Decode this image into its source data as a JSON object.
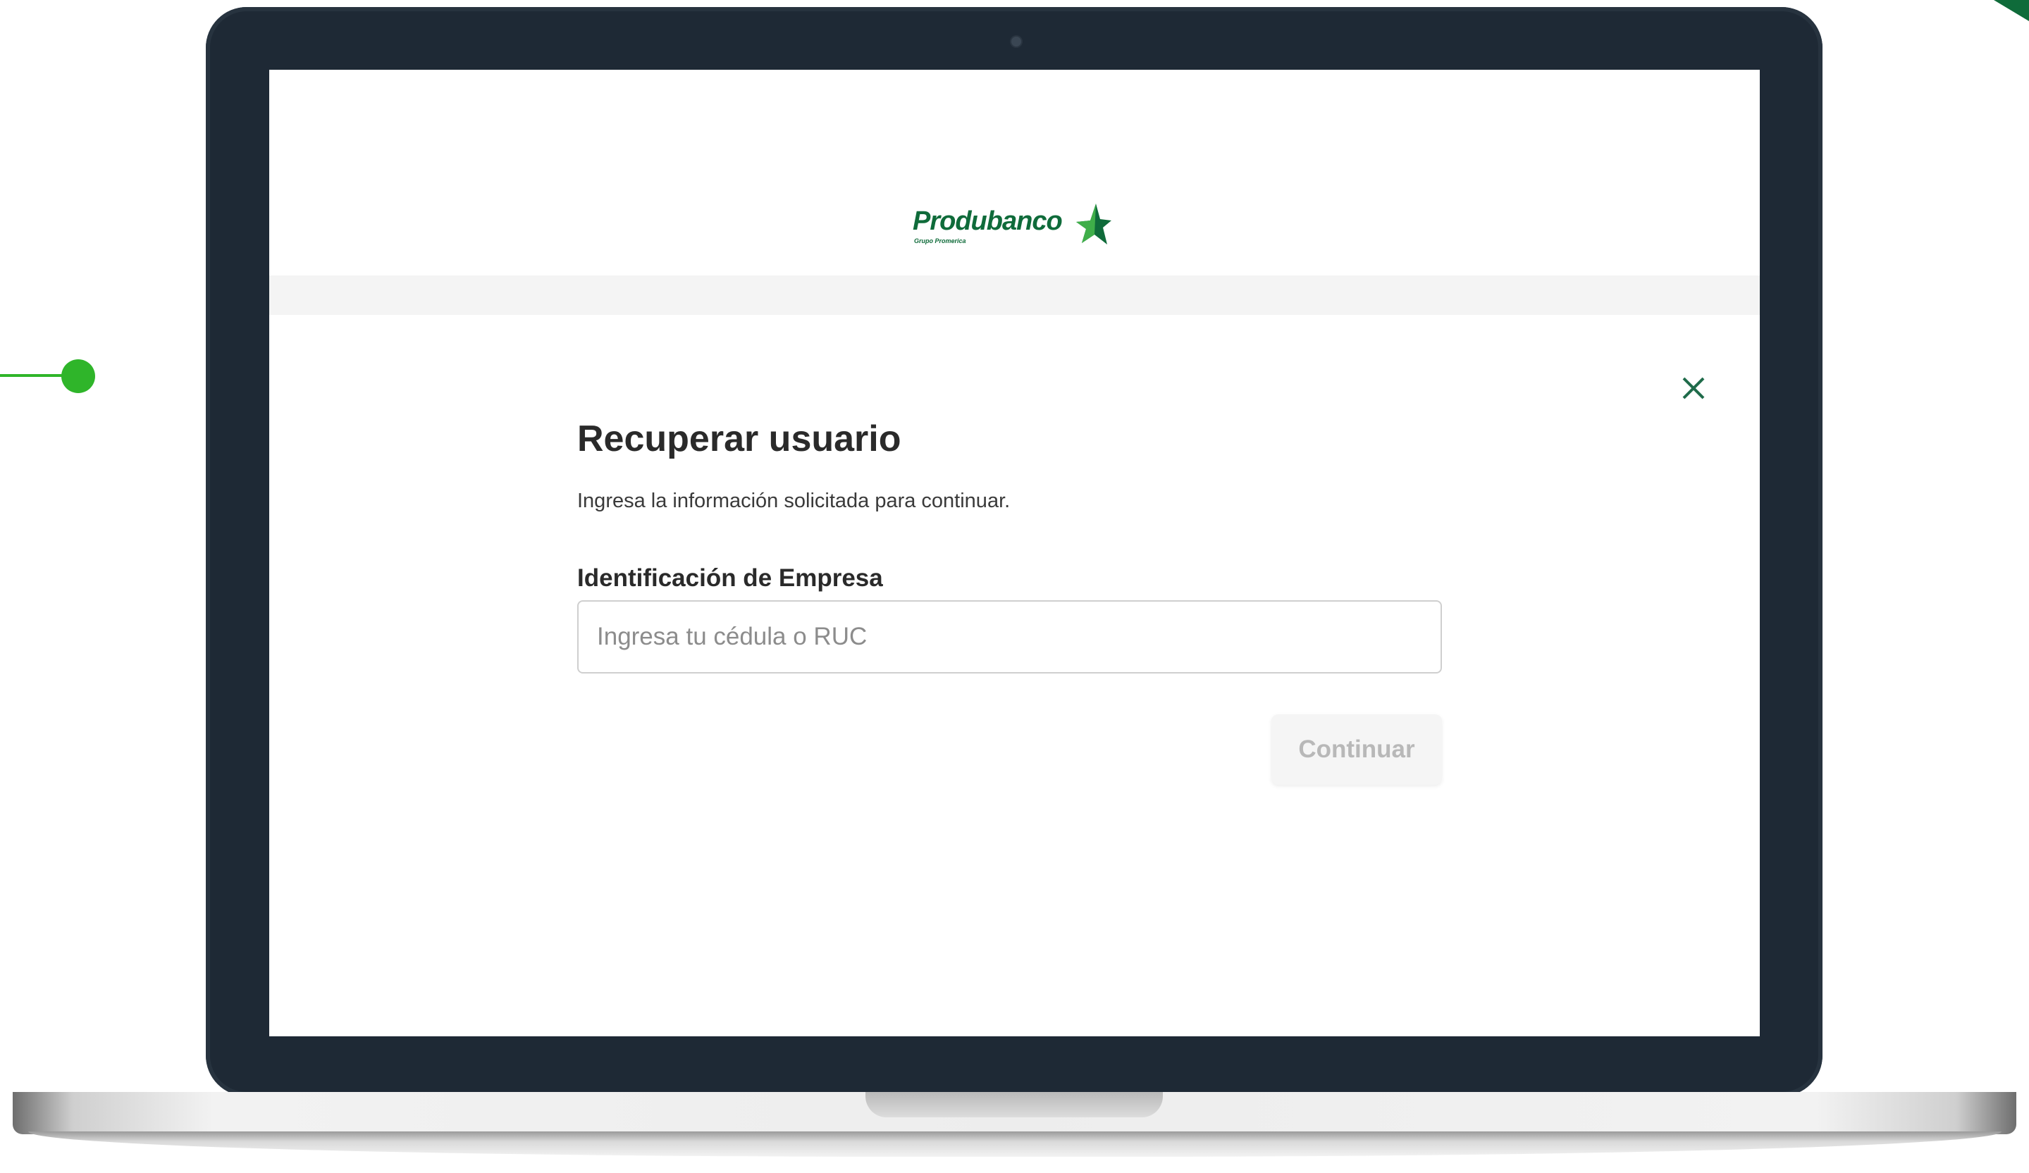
{
  "brand": {
    "name": "Produbanco",
    "tagline": "Grupo Promerica",
    "color": "#0f6b3a",
    "star_dark": "#0f6b3a",
    "star_light": "#3fae49"
  },
  "accent_color": "#2fb52a",
  "close_icon": "close-icon",
  "form": {
    "title": "Recuperar usuario",
    "subtitle": "Ingresa la información solicitada para continuar.",
    "field_label": "Identificación de Empresa",
    "field_value": "",
    "field_placeholder": "Ingresa tu cédula o RUC",
    "continue_label": "Continuar",
    "continue_state": "disabled"
  }
}
